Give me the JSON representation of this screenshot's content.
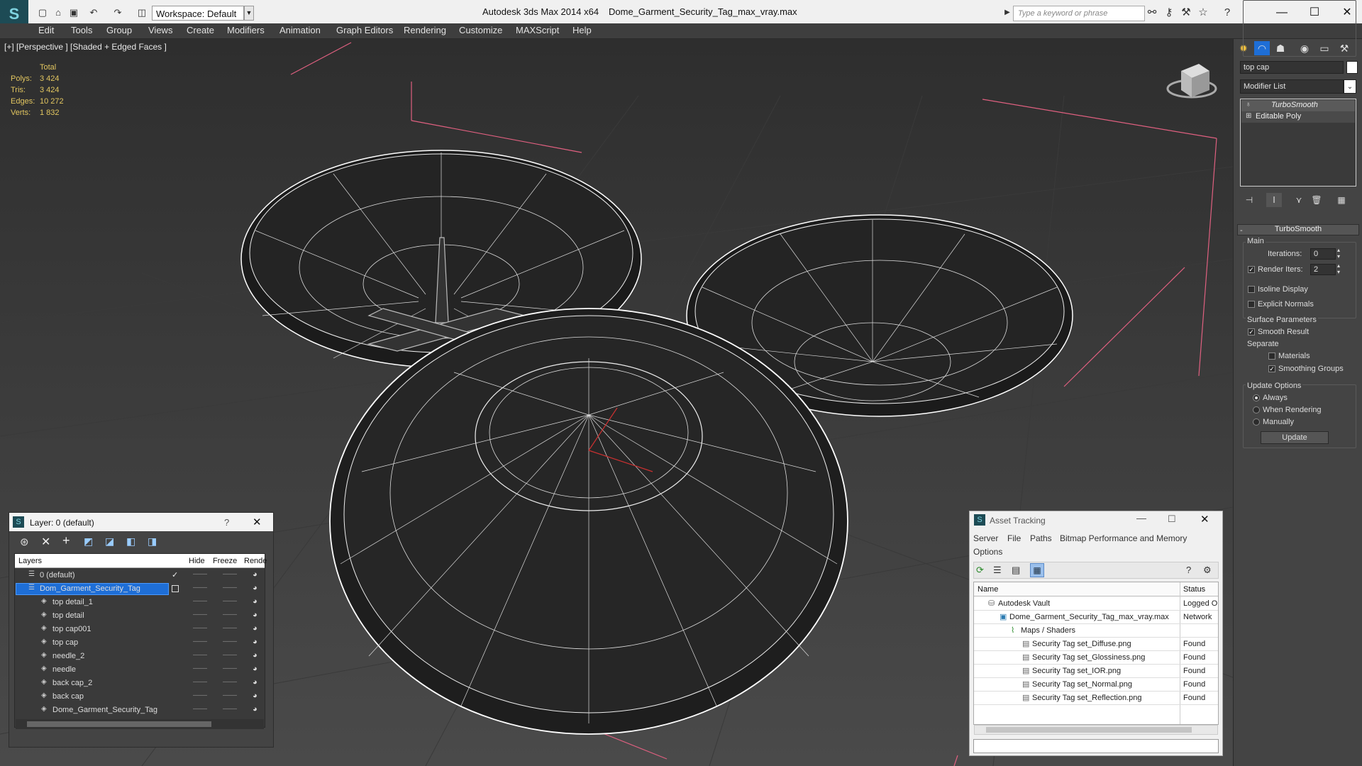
{
  "app": {
    "title": "Autodesk 3ds Max  2014 x64",
    "file": "Dome_Garment_Security_Tag_max_vray.max",
    "workspace": "Workspace: Default",
    "search_placeholder": "Type a keyword or phrase"
  },
  "menu": [
    "Edit",
    "Tools",
    "Group",
    "Views",
    "Create",
    "Modifiers",
    "Animation",
    "Graph Editors",
    "Rendering",
    "Customize",
    "MAXScript",
    "Help"
  ],
  "viewport": {
    "label": "[+] [Perspective ] [Shaded + Edged Faces ]",
    "stats": {
      "header": "Total",
      "rows": [
        {
          "label": "Polys:",
          "value": "3 424"
        },
        {
          "label": "Tris:",
          "value": "3 424"
        },
        {
          "label": "Edges:",
          "value": "10 272"
        },
        {
          "label": "Verts:",
          "value": "1 832"
        }
      ]
    }
  },
  "command_panel": {
    "object_name": "top cap",
    "modifier_list": "Modifier List",
    "stack": [
      "TurboSmooth",
      "Editable Poly"
    ],
    "rollout_title": "TurboSmooth",
    "main_label": "Main",
    "iterations_label": "Iterations:",
    "iterations_value": "0",
    "render_iters_label": "Render Iters:",
    "render_iters_value": "2",
    "render_iters_checked": true,
    "isoline_label": "Isoline Display",
    "explicit_label": "Explicit Normals",
    "surface_label": "Surface Parameters",
    "smooth_result_label": "Smooth Result",
    "separate_label": "Separate",
    "materials_label": "Materials",
    "smoothing_groups_label": "Smoothing Groups",
    "update_options_label": "Update Options",
    "always_label": "Always",
    "when_rendering_label": "When Rendering",
    "manually_label": "Manually",
    "update_button": "Update"
  },
  "layer_panel": {
    "title": "Layer: 0 (default)",
    "help": "?",
    "columns": [
      "Layers",
      "Hide",
      "Freeze",
      "Rende"
    ],
    "rows": [
      {
        "name": "0 (default)",
        "level": 0,
        "check": true
      },
      {
        "name": "Dom_Garment_Security_Tag",
        "level": 0,
        "selected": true
      },
      {
        "name": "top detail_1",
        "level": 1
      },
      {
        "name": "top detail",
        "level": 1
      },
      {
        "name": "top cap001",
        "level": 1
      },
      {
        "name": "top cap",
        "level": 1
      },
      {
        "name": "needle_2",
        "level": 1
      },
      {
        "name": "needle",
        "level": 1
      },
      {
        "name": "back cap_2",
        "level": 1
      },
      {
        "name": "back cap",
        "level": 1
      },
      {
        "name": "Dome_Garment_Security_Tag",
        "level": 1
      }
    ]
  },
  "asset_panel": {
    "title": "Asset Tracking",
    "menu": [
      "Server",
      "File",
      "Paths",
      "Bitmap Performance and Memory"
    ],
    "menu2": "Options",
    "columns": [
      "Name",
      "Status"
    ],
    "rows": [
      {
        "name": "Autodesk Vault",
        "status": "Logged O",
        "level": 1
      },
      {
        "name": "Dome_Garment_Security_Tag_max_vray.max",
        "status": "Network",
        "level": 2
      },
      {
        "name": "Maps / Shaders",
        "status": "",
        "level": 3
      },
      {
        "name": "Security Tag set_Diffuse.png",
        "status": "Found",
        "level": 4
      },
      {
        "name": "Security Tag set_Glossiness.png",
        "status": "Found",
        "level": 4
      },
      {
        "name": "Security Tag set_IOR.png",
        "status": "Found",
        "level": 4
      },
      {
        "name": "Security Tag set_Normal.png",
        "status": "Found",
        "level": 4
      },
      {
        "name": "Security Tag set_Reflection.png",
        "status": "Found",
        "level": 4
      }
    ]
  },
  "colors": {
    "accent": "#1e6ed6",
    "stats_yellow": "#e2c660",
    "wire": "#ffffff",
    "helper_pink": "#e06080"
  }
}
